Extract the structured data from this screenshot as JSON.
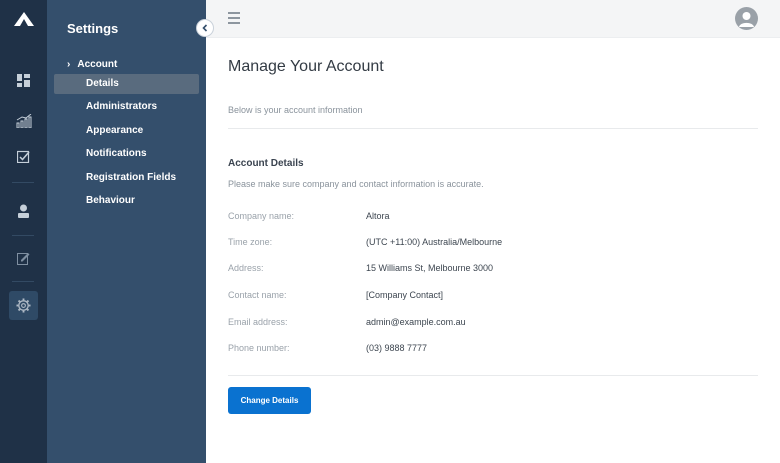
{
  "sidebar": {
    "title": "Settings",
    "section": "Account",
    "items": [
      {
        "label": "Details"
      },
      {
        "label": "Administrators"
      },
      {
        "label": "Appearance"
      },
      {
        "label": "Notifications"
      },
      {
        "label": "Registration Fields"
      },
      {
        "label": "Behaviour"
      }
    ],
    "active_item": "Details"
  },
  "rail": {
    "icons": [
      "logo-icon",
      "dashboard-icon",
      "chart-icon",
      "checkbox-icon",
      "user-icon",
      "edit-icon",
      "gear-icon"
    ],
    "active": "gear-icon"
  },
  "main": {
    "title": "Manage Your Account",
    "subtitle": "Below is your account information",
    "section_title": "Account Details",
    "section_note": "Please make sure company and contact information is accurate.",
    "fields": [
      {
        "label": "Company name:",
        "value": "Altora"
      },
      {
        "label": "Time zone:",
        "value": "(UTC +11:00) Australia/Melbourne"
      },
      {
        "label": "Address:",
        "value": "15 Williams St, Melbourne 3000"
      },
      {
        "label": "Contact name:",
        "value": "[Company Contact]"
      },
      {
        "label": "Email address:",
        "value": "admin@example.com.au"
      },
      {
        "label": "Phone number:",
        "value": "(03) 9888 7777"
      }
    ],
    "button_label": "Change Details"
  },
  "colors": {
    "rail_bg": "#1f3147",
    "sidebar_bg": "#344f6c",
    "active_item_bg": "#596b7e",
    "primary_button": "#0a72d0"
  }
}
